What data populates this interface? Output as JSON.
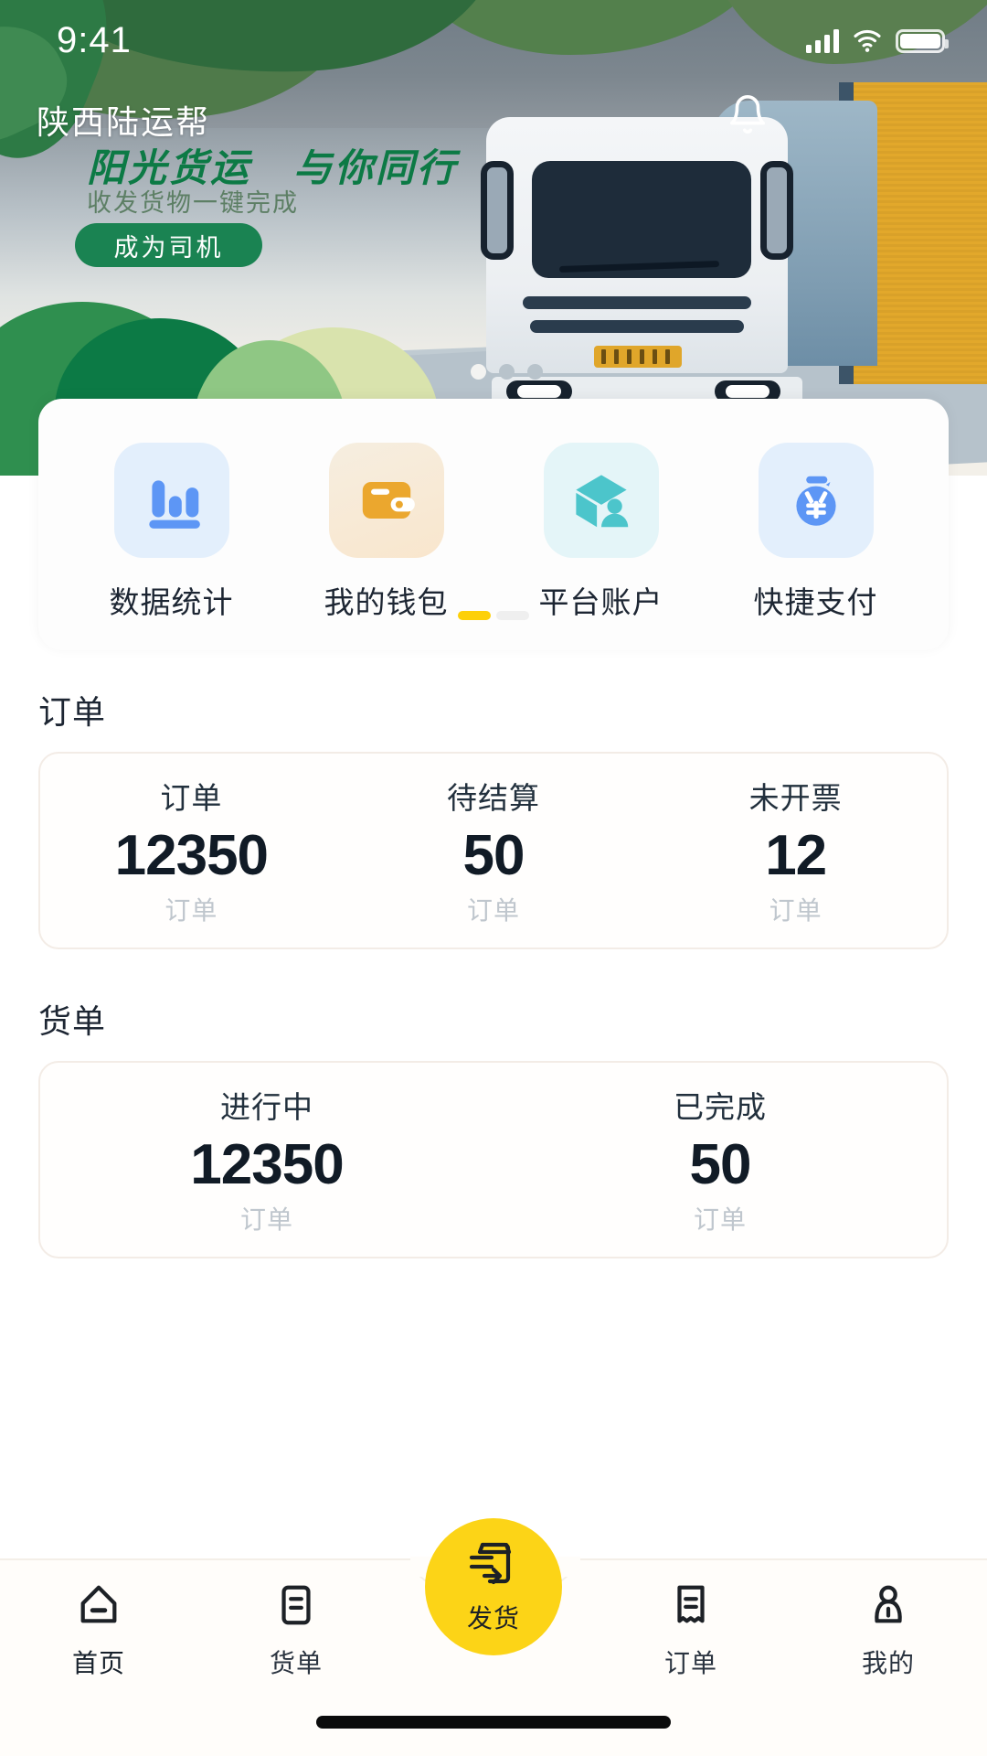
{
  "status_bar": {
    "time": "9:41",
    "signal_icon": "cellular-signal-icon",
    "wifi_icon": "wifi-icon",
    "battery_icon": "battery-full-icon"
  },
  "hero": {
    "brand": "陕西陆运帮",
    "slogan_left": "阳光货运",
    "slogan_right": "与你同行",
    "subslogan": "收发货物一键完成",
    "cta_label": "成为司机",
    "bell_icon": "bell-icon",
    "carousel_dots": 3,
    "carousel_active_index": 0,
    "colors": {
      "slogan_green": "#0c7a45",
      "cta_green": "#1a8352"
    }
  },
  "quick_actions": {
    "items": [
      {
        "label": "数据统计",
        "icon": "bar-chart-icon",
        "tile_bg": "#e3effc",
        "icon_color": "#5d96f5"
      },
      {
        "label": "我的钱包",
        "icon": "wallet-icon",
        "tile_bg": "#f9ecd8",
        "icon_color": "#eba72e"
      },
      {
        "label": "平台账户",
        "icon": "account-box-icon",
        "tile_bg": "#e4f5f8",
        "icon_color": "#4cc5cb"
      },
      {
        "label": "快捷支付",
        "icon": "money-bag-yen-icon",
        "tile_bg": "#e3effc",
        "icon_color": "#5d96f5"
      }
    ],
    "pager": {
      "pages": 2,
      "active_index": 0,
      "active_color": "#fdd008"
    }
  },
  "orders_section": {
    "title": "订单",
    "cells": [
      {
        "name": "订单",
        "value": "12350",
        "unit": "订单"
      },
      {
        "name": "待结算",
        "value": "50",
        "unit": "订单"
      },
      {
        "name": "未开票",
        "value": "12",
        "unit": "订单"
      }
    ]
  },
  "waybills_section": {
    "title": "货单",
    "cells": [
      {
        "name": "进行中",
        "value": "12350",
        "unit": "订单"
      },
      {
        "name": "已完成",
        "value": "50",
        "unit": "订单"
      }
    ]
  },
  "tabbar": {
    "active_color": "#fcd417",
    "items": [
      {
        "label": "首页",
        "icon": "home-icon",
        "active": true
      },
      {
        "label": "货单",
        "icon": "document-icon",
        "active": false
      },
      {
        "label": "订单",
        "icon": "receipt-icon",
        "active": false
      },
      {
        "label": "我的",
        "icon": "person-icon",
        "active": false
      }
    ],
    "fab": {
      "label": "发货",
      "icon": "ship-package-icon",
      "color": "#fcd417"
    }
  }
}
